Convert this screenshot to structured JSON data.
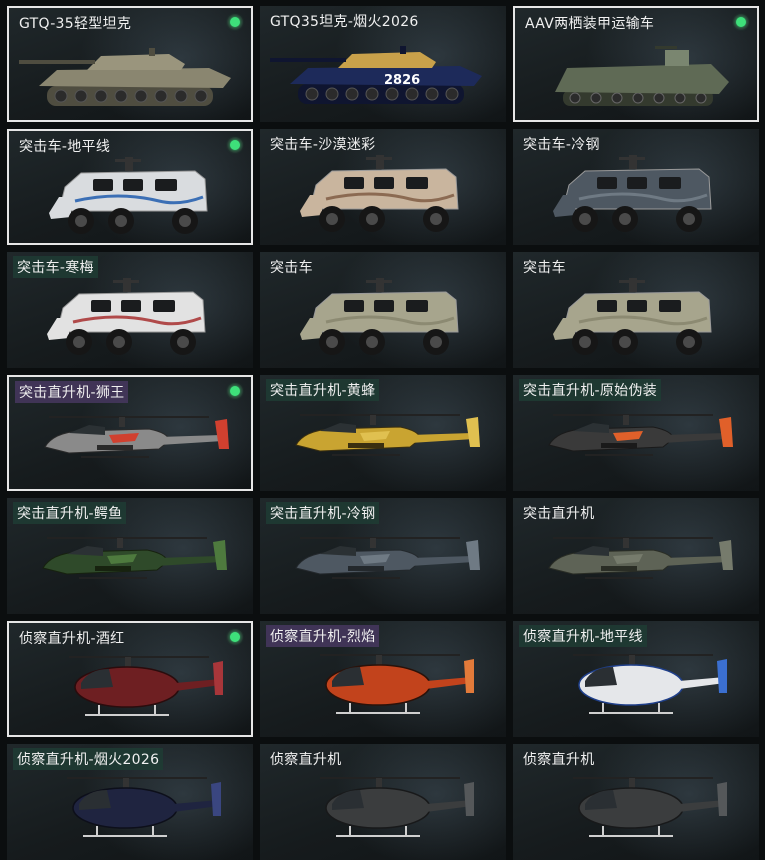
{
  "skins": [
    {
      "name": "GTQ-35轻型坦克",
      "type": "tank",
      "selected": true,
      "equipped": true,
      "tint": "",
      "colors": {
        "body": "#8a8670",
        "dark": "#4f4d40",
        "accent": "#9a957d"
      }
    },
    {
      "name": "GTQ35坦克-烟火2026",
      "type": "tank",
      "selected": false,
      "equipped": false,
      "tint": "",
      "badge": "2826",
      "colors": {
        "body": "#1d2a5a",
        "dark": "#0f1530",
        "accent": "#c9a14a"
      }
    },
    {
      "name": "AAV两栖装甲运输车",
      "type": "amphib",
      "selected": true,
      "equipped": true,
      "tint": "",
      "colors": {
        "body": "#5f6a55",
        "dark": "#343a2e",
        "accent": "#7a8670"
      }
    },
    {
      "name": "突击车-地平线",
      "type": "truck",
      "selected": true,
      "equipped": true,
      "tint": "",
      "colors": {
        "body": "#d9dcdf",
        "dark": "#222",
        "accent": "#3b6fb5"
      }
    },
    {
      "name": "突击车-沙漠迷彩",
      "type": "truck",
      "selected": false,
      "equipped": false,
      "tint": "",
      "colors": {
        "body": "#c9b59e",
        "dark": "#222",
        "accent": "#8b6a52"
      }
    },
    {
      "name": "突击车-冷钢",
      "type": "truck",
      "selected": false,
      "equipped": false,
      "tint": "",
      "colors": {
        "body": "#4e5862",
        "dark": "#1c1e20",
        "accent": "#6f7a84"
      }
    },
    {
      "name": "突击车-寒梅",
      "type": "truck",
      "selected": false,
      "equipped": false,
      "tint": "green",
      "colors": {
        "body": "#e2e2e2",
        "dark": "#222",
        "accent": "#b04a4a"
      }
    },
    {
      "name": "突击车",
      "type": "truck",
      "selected": false,
      "equipped": false,
      "tint": "",
      "colors": {
        "body": "#a7a58d",
        "dark": "#222",
        "accent": "#8c8a72"
      }
    },
    {
      "name": "突击车",
      "type": "truck",
      "selected": false,
      "equipped": false,
      "tint": "",
      "colors": {
        "body": "#a7a58d",
        "dark": "#222",
        "accent": "#8c8a72"
      }
    },
    {
      "name": "突击直升机-狮王",
      "type": "attack-heli",
      "selected": true,
      "equipped": true,
      "tint": "purple",
      "colors": {
        "body": "#8a8a8a",
        "dark": "#2a2a2a",
        "accent": "#d0402f"
      }
    },
    {
      "name": "突击直升机-黄蜂",
      "type": "attack-heli",
      "selected": false,
      "equipped": false,
      "tint": "green",
      "colors": {
        "body": "#c9a431",
        "dark": "#3a2f10",
        "accent": "#e0c050"
      }
    },
    {
      "name": "突击直升机-原始伪装",
      "type": "attack-heli",
      "selected": false,
      "equipped": false,
      "tint": "green",
      "colors": {
        "body": "#3a3a3a",
        "dark": "#1a1a1a",
        "accent": "#e0602a"
      }
    },
    {
      "name": "突击直升机-鳄鱼",
      "type": "attack-heli",
      "selected": false,
      "equipped": false,
      "tint": "green",
      "colors": {
        "body": "#2f4a2a",
        "dark": "#17220f",
        "accent": "#4e7a3e"
      }
    },
    {
      "name": "突击直升机-冷钢",
      "type": "attack-heli",
      "selected": false,
      "equipped": false,
      "tint": "green",
      "colors": {
        "body": "#4e5862",
        "dark": "#23282c",
        "accent": "#6f7a84"
      }
    },
    {
      "name": "突击直升机",
      "type": "attack-heli",
      "selected": false,
      "equipped": false,
      "tint": "",
      "colors": {
        "body": "#5e6356",
        "dark": "#2a2d25",
        "accent": "#767b6c"
      }
    },
    {
      "name": "侦察直升机-酒红",
      "type": "scout-heli",
      "selected": true,
      "equipped": true,
      "tint": "",
      "colors": {
        "body": "#6e1f22",
        "dark": "#2a0c0d",
        "accent": "#a8363a"
      }
    },
    {
      "name": "侦察直升机-烈焰",
      "type": "scout-heli",
      "selected": false,
      "equipped": false,
      "tint": "purple",
      "colors": {
        "body": "#c2431c",
        "dark": "#2a120a",
        "accent": "#e27a3a"
      }
    },
    {
      "name": "侦察直升机-地平线",
      "type": "scout-heli",
      "selected": false,
      "equipped": false,
      "tint": "green",
      "colors": {
        "body": "#e5e7ea",
        "dark": "#1f3f8a",
        "accent": "#3b6fd0"
      }
    },
    {
      "name": "侦察直升机-烟火2026",
      "type": "scout-heli",
      "selected": false,
      "equipped": false,
      "tint": "green",
      "colors": {
        "body": "#1f2440",
        "dark": "#0d0f1a",
        "accent": "#3a4680"
      }
    },
    {
      "name": "侦察直升机",
      "type": "scout-heli",
      "selected": false,
      "equipped": false,
      "tint": "",
      "colors": {
        "body": "#3b3d3e",
        "dark": "#18191a",
        "accent": "#55585a"
      }
    },
    {
      "name": "侦察直升机",
      "type": "scout-heli",
      "selected": false,
      "equipped": false,
      "tint": "",
      "colors": {
        "body": "#3b3d3e",
        "dark": "#18191a",
        "accent": "#55585a"
      }
    }
  ]
}
